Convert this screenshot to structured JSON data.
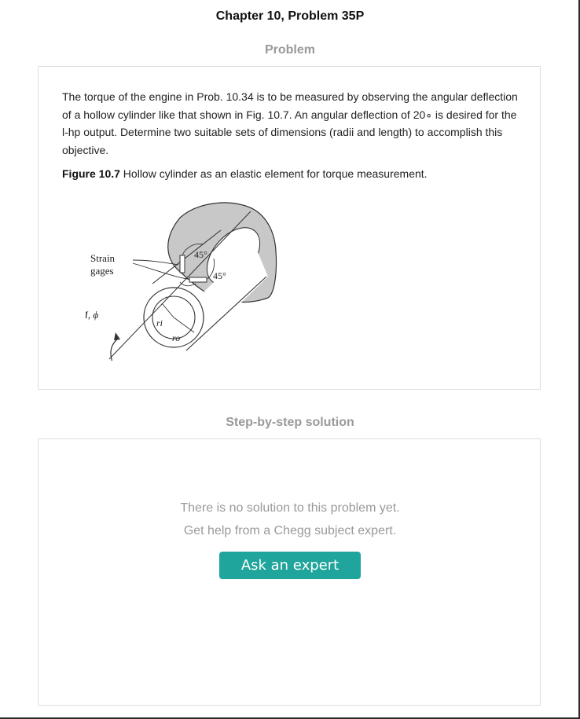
{
  "header": {
    "title": "Chapter 10, Problem 35P"
  },
  "problem": {
    "heading": "Problem",
    "text": "The torque of the engine in Prob. 10.34 is to be measured by observing the angular deflection of a hollow cylinder like that shown in Fig. 10.7. An angular deflection of 20∘ is desired for the l-hp output. Determine two suitable sets of dimensions (radii and length) to accomplish this objective.",
    "figure_label": "Figure 10.7",
    "figure_caption": " Hollow cylinder as an elastic element for torque measurement.",
    "figure": {
      "strain_label_1": "Strain",
      "strain_label_2": "gages",
      "angle_top": "45°",
      "angle_right": "45°",
      "moment_label": "M, ϕ",
      "ri_label": "ri",
      "ro_label": "ro"
    }
  },
  "solution": {
    "heading": "Step-by-step solution",
    "empty_line_1": "There is no solution to this problem yet.",
    "empty_line_2": "Get help from a Chegg subject expert.",
    "button_label": "Ask an expert"
  },
  "colors": {
    "accent": "#1fa59b",
    "muted_text": "#999999",
    "border": "#dedede",
    "wall_fill": "#c8c8c8"
  }
}
